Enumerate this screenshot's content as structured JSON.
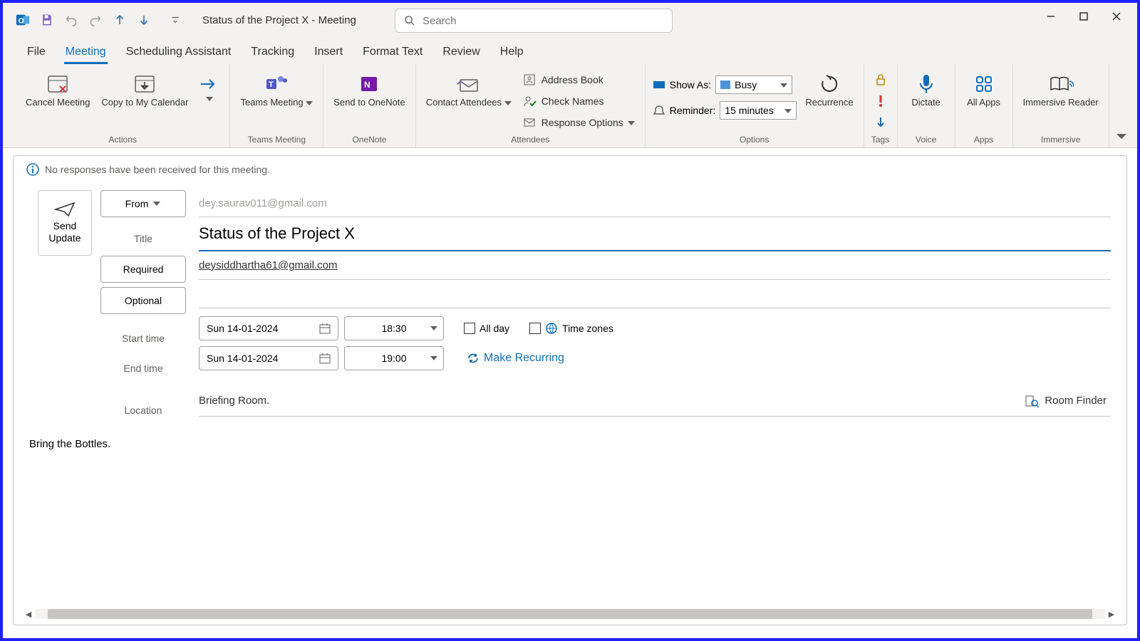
{
  "window": {
    "title": "Status of the Project X  -  Meeting",
    "search_placeholder": "Search"
  },
  "tabs": {
    "file": "File",
    "meeting": "Meeting",
    "scheduling": "Scheduling Assistant",
    "tracking": "Tracking",
    "insert": "Insert",
    "format": "Format Text",
    "review": "Review",
    "help": "Help"
  },
  "ribbon": {
    "actions": {
      "group": "Actions",
      "cancel": "Cancel Meeting",
      "copy_cal": "Copy to My Calendar"
    },
    "teams": {
      "group": "Teams Meeting",
      "btn": "Teams Meeting"
    },
    "onenote": {
      "group": "OneNote",
      "btn": "Send to OneNote"
    },
    "attendees": {
      "group": "Attendees",
      "contact": "Contact Attendees",
      "address": "Address Book",
      "check": "Check Names",
      "response": "Response Options"
    },
    "options": {
      "group": "Options",
      "show_as": "Show As:",
      "show_as_val": "Busy",
      "reminder": "Reminder:",
      "reminder_val": "15 minutes",
      "recurrence": "Recurrence"
    },
    "tags": {
      "group": "Tags"
    },
    "voice": {
      "group": "Voice",
      "dictate": "Dictate"
    },
    "apps": {
      "group": "Apps",
      "all": "All Apps"
    },
    "immersive": {
      "group": "Immersive",
      "reader": "Immersive Reader"
    }
  },
  "info": {
    "message": "No responses have been received for this meeting."
  },
  "form": {
    "send": "Send Update",
    "from_btn": "From",
    "from_value": "dey.saurav011@gmail.com",
    "title_label": "Title",
    "title_value": "Status of the Project X",
    "required_btn": "Required",
    "required_value": "deysiddhartha61@gmail.com",
    "optional_btn": "Optional",
    "optional_value": "",
    "start_label": "Start time",
    "start_date": "Sun 14-01-2024",
    "start_time": "18:30",
    "end_label": "End time",
    "end_date": "Sun 14-01-2024",
    "end_time": "19:00",
    "all_day": "All day",
    "time_zones": "Time zones",
    "make_recurring": "Make Recurring",
    "location_label": "Location",
    "location_value": "Briefing Room.",
    "room_finder": "Room Finder",
    "body": "Bring the Bottles."
  }
}
